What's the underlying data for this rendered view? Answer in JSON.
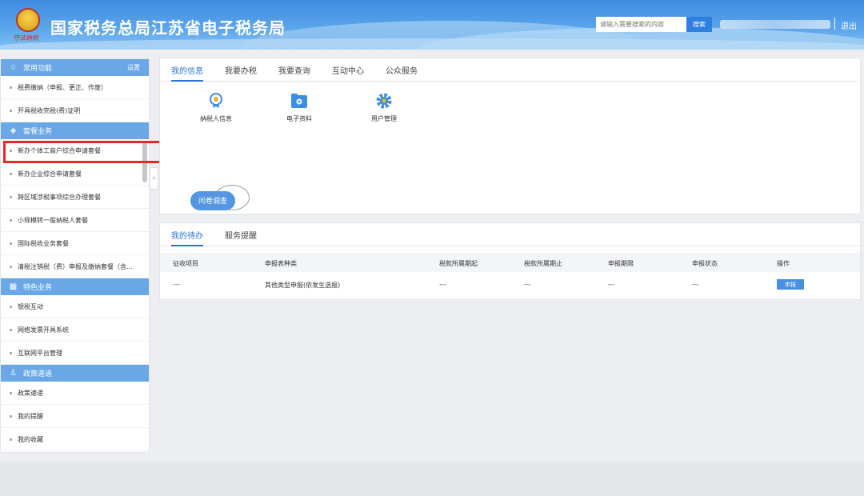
{
  "header": {
    "title": "国家税务总局江苏省电子税务局",
    "logo_motto": "守法纳税",
    "search_placeholder": "请输入需要搜索的内容",
    "search_button": "搜索",
    "logout": "退出"
  },
  "sidebar": {
    "sec_common": {
      "label": "常用功能",
      "settings": "设置",
      "icon": "star-icon"
    },
    "common_items": [
      "税费缴纳（申报、更正、作废）",
      "开具税收完税(费)证明"
    ],
    "sec_package": {
      "label": "套餐业务",
      "icon": "layers-icon"
    },
    "package_items": [
      "新办个体工商户综合申请套餐",
      "新办企业综合申请套餐",
      "跨区域涉税事项综合办理套餐",
      "小规模转一般纳税人套餐",
      "国际税收业务套餐",
      "清税注销税（费）申报及缴纳套餐（含..."
    ],
    "sec_special": {
      "label": "特色业务",
      "icon": "grid-icon"
    },
    "special_items": [
      "银税互动",
      "网络发票开具系统",
      "互联网平台管理"
    ],
    "sec_policy": {
      "label": "政策速递",
      "icon": "user-icon"
    },
    "policy_items": [
      "政策速递",
      "我的提醒",
      "我的收藏"
    ],
    "collapse": "«"
  },
  "info_panel": {
    "tabs": [
      "我的信息",
      "我要办税",
      "我要查询",
      "互动中心",
      "公众服务"
    ],
    "quick_links": [
      {
        "label": "纳税人信息",
        "icon": "medal-icon"
      },
      {
        "label": "电子资料",
        "icon": "folder-icon"
      },
      {
        "label": "用户管理",
        "icon": "gear-icon"
      }
    ],
    "survey": "问卷调查"
  },
  "todo_panel": {
    "tabs": [
      "我的待办",
      "服务提醒"
    ],
    "columns": [
      "征收项目",
      "申报表种类",
      "税款所属期起",
      "税款所属期止",
      "申报期限",
      "申报状态",
      "操作"
    ],
    "rows": [
      {
        "item": "---",
        "form": "其他类型申报(依发生选报)",
        "start": "---",
        "end": "---",
        "deadline": "---",
        "status": "---",
        "action": "申报"
      }
    ]
  },
  "colors": {
    "accent": "#2d74d6",
    "section": "#69a7e6",
    "highlight": "#e52a25"
  }
}
